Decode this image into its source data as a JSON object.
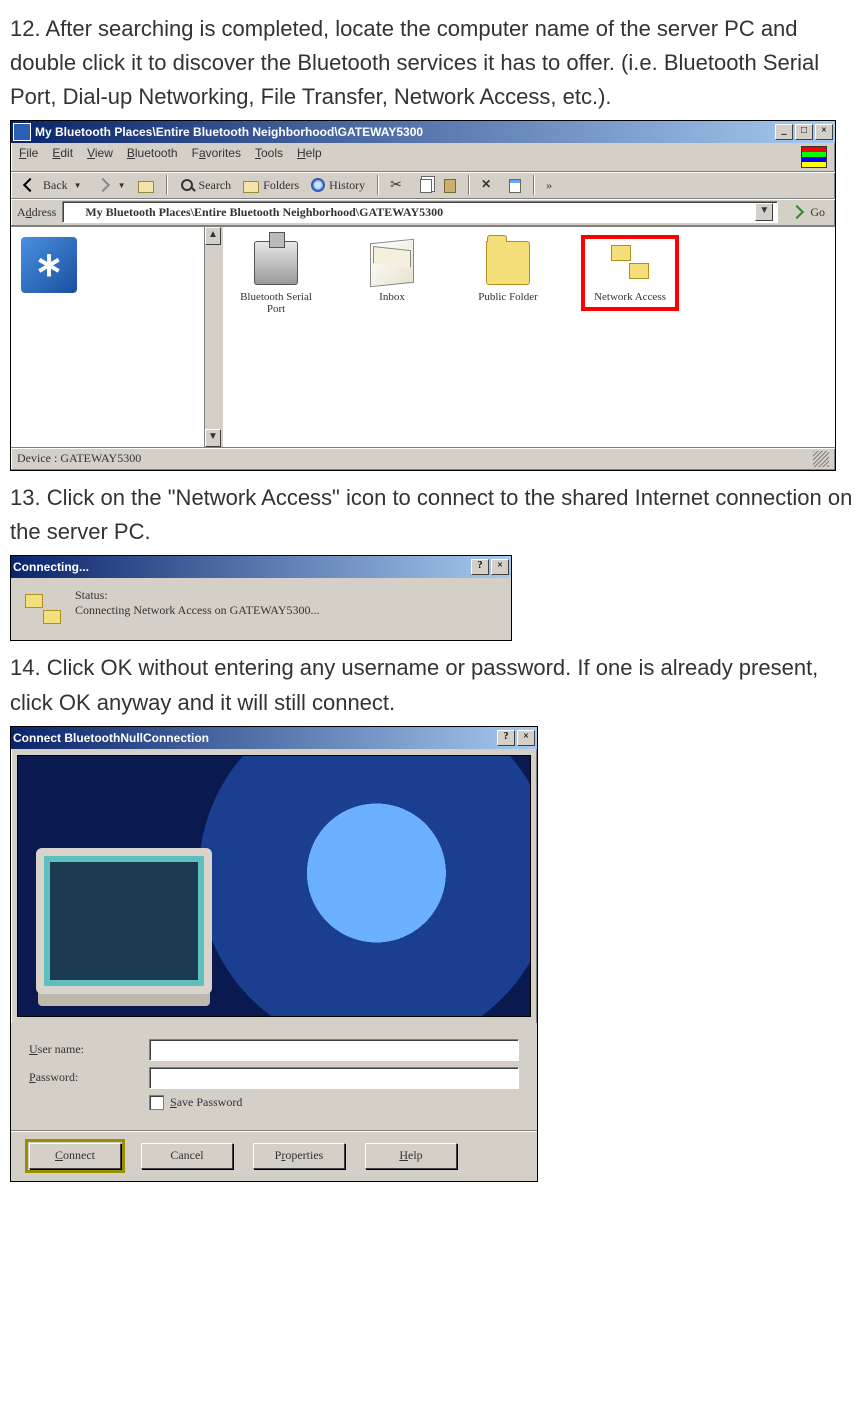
{
  "step12": "12. After searching is completed, locate the computer name of the server PC and double click it to discover the Bluetooth services it has to offer. (i.e. Bluetooth Serial Port, Dial-up Networking, File Transfer, Network Access, etc.).",
  "step13": "13. Click on the \"Network Access\" icon to connect to the shared Internet connection on the server PC.",
  "step14": "14. Click OK without entering any username or password. If one is already present, click OK anyway and it will still connect.",
  "explorer": {
    "title": "My Bluetooth Places\\Entire Bluetooth Neighborhood\\GATEWAY5300",
    "menu": {
      "file": "File",
      "edit": "Edit",
      "view": "View",
      "bluetooth": "Bluetooth",
      "favorites": "Favorites",
      "tools": "Tools",
      "help": "Help"
    },
    "toolbar": {
      "back": "Back",
      "search": "Search",
      "folders": "Folders",
      "history": "History",
      "go": "Go",
      "address_label": "Address"
    },
    "address": "My Bluetooth Places\\Entire Bluetooth Neighborhood\\GATEWAY5300",
    "icons": {
      "serial": "Bluetooth Serial Port",
      "inbox": "Inbox",
      "public": "Public Folder",
      "netaccess": "Network Access"
    },
    "status": "Device : GATEWAY5300"
  },
  "connecting": {
    "title": "Connecting...",
    "status_label": "Status:",
    "status_text": "Connecting Network Access on GATEWAY5300..."
  },
  "connect": {
    "title": "Connect BluetoothNullConnection",
    "user_label": "User name:",
    "pass_label": "Password:",
    "save_label": "Save Password",
    "buttons": {
      "connect": "Connect",
      "cancel": "Cancel",
      "properties": "Properties",
      "help": "Help"
    }
  }
}
